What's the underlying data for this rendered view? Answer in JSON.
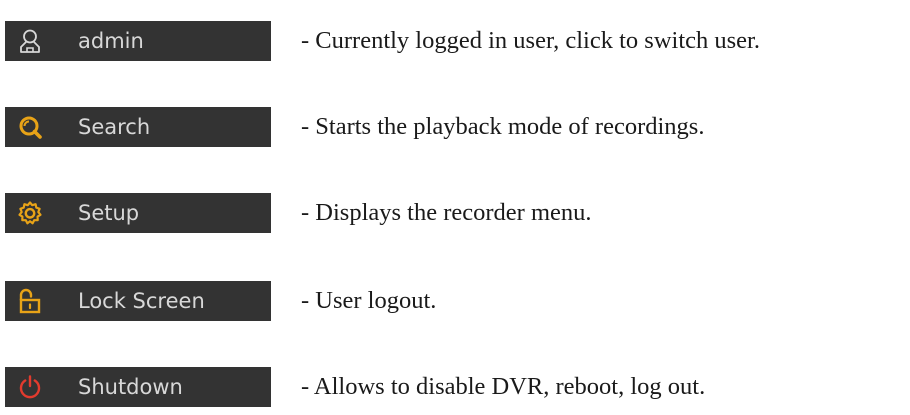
{
  "colors": {
    "button_background": "#333333",
    "button_text": "#d8d8d8",
    "icon_accent": "#e8a317",
    "icon_user": "#d8d8d8",
    "icon_power": "#e23b2e",
    "description_text": "#1a1a1a"
  },
  "menu": {
    "items": [
      {
        "icon": "user-icon",
        "label": "admin",
        "description": "- Currently logged in user, click to switch user."
      },
      {
        "icon": "search-icon",
        "label": "Search",
        "description": "- Starts the playback mode of recordings."
      },
      {
        "icon": "gear-icon",
        "label": "Setup",
        "description": "- Displays the recorder menu."
      },
      {
        "icon": "unlock-icon",
        "label": "Lock Screen",
        "description": "- User logout."
      },
      {
        "icon": "power-icon",
        "label": "Shutdown",
        "description": "- Allows to disable DVR, reboot, log out."
      }
    ]
  }
}
